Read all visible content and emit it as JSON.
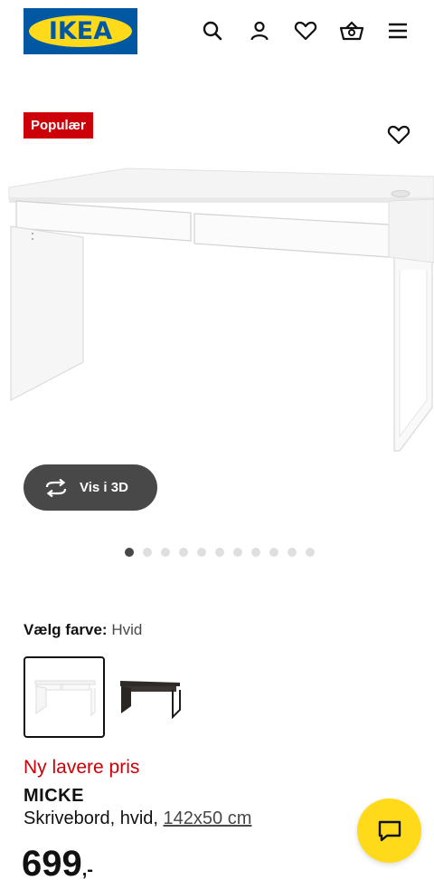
{
  "header": {
    "logo_text": "IKEA",
    "icons": [
      "search-icon",
      "account-icon",
      "heart-icon",
      "basket-icon",
      "menu-icon"
    ]
  },
  "product": {
    "badge": "Populær",
    "view_3d_label": "Vis i 3D",
    "gallery": {
      "count": 11,
      "active_index": 0
    },
    "color_label": "Vælg farve:",
    "color_value": "Hvid",
    "swatches": [
      "Hvid",
      "Sortbrun"
    ],
    "price_label": "Ny lavere pris",
    "name": "MICKE",
    "description": "Skrivebord, hvid,",
    "size": "142x50 cm",
    "price": "699",
    "price_suffix": ",-"
  },
  "colors": {
    "ikea_blue": "#0058a3",
    "ikea_yellow": "#ffda1a",
    "price_red": "#cc0008",
    "dark_grey": "#484848"
  }
}
